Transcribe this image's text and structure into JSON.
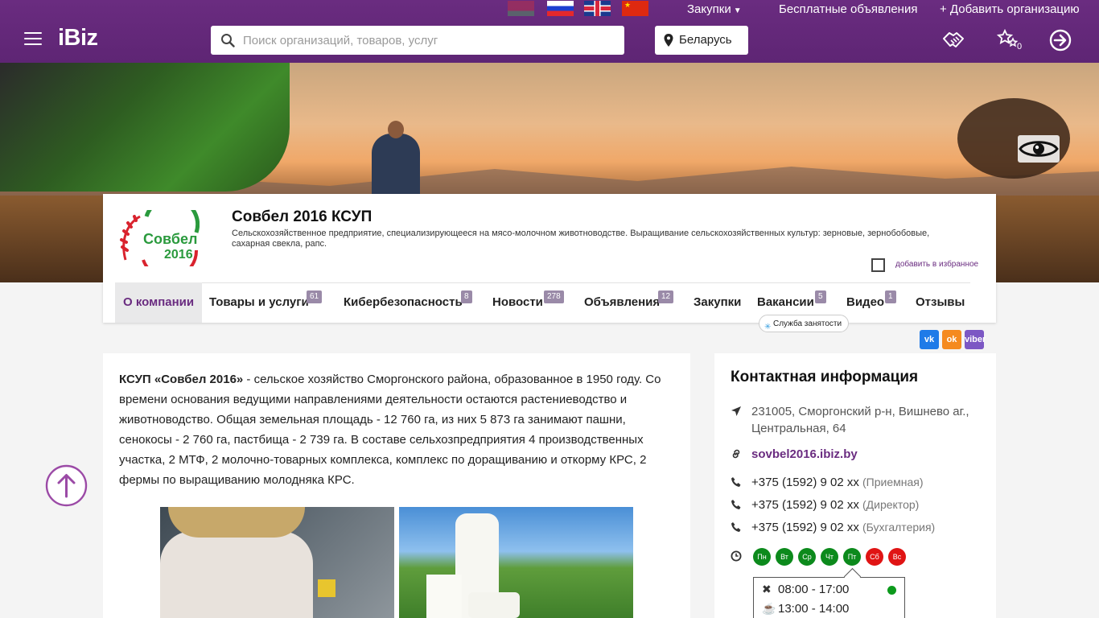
{
  "topbar": {
    "flags": [
      "flag-belarus",
      "flag-russia",
      "flag-uk",
      "flag-china"
    ],
    "procurement_label": "Закупки",
    "free_ads_label": "Бесплатные объявления",
    "add_org_label": "+ Добавить организацию"
  },
  "header": {
    "logo": "iBiz",
    "search_placeholder": "Поиск организаций, товаров, услуг",
    "region": "Беларусь",
    "favorites_count": "0",
    "icons": [
      "handshake-icon",
      "favorites-stars-icon",
      "login-icon"
    ]
  },
  "company": {
    "name": "Совбел 2016 КСУП",
    "description": "Сельскохозяйственное предприятие, специализирующееся на мясо-молочном животноводстве. Выращивание сельскохозяйственных культур: зерновые, зернобобовые, сахарная свекла, рапс.",
    "add_favorite_label": "добавить в избранное",
    "logo_text_1": "Совбел",
    "logo_text_2": "2016"
  },
  "tabs": [
    {
      "label": "О компании",
      "count": ""
    },
    {
      "label": "Товары и услуги",
      "count": "61"
    },
    {
      "label": "Кибербезопасность",
      "count": "8"
    },
    {
      "label": "Новости",
      "count": "278"
    },
    {
      "label": "Объявления",
      "count": "12"
    },
    {
      "label": "Закупки",
      "count": ""
    },
    {
      "label": "Вакансии",
      "count": "5"
    },
    {
      "label": "Видео",
      "count": "1"
    },
    {
      "label": "Отзывы",
      "count": ""
    }
  ],
  "service_chip": "Служба занятости",
  "share": {
    "vk": "vk",
    "ok": "ok",
    "viber": "viber",
    "colors": {
      "vk": "#1f7be8",
      "ok": "#f58a1f",
      "viber": "#7c57c4"
    }
  },
  "about": {
    "lead": "КСУП «Совбел 2016»",
    "text": " - сельское хозяйство Сморгонского района, образованное в 1950 году. Со времени основания ведущими направлениями деятельности остаются растениеводство и животноводство. Общая земельная площадь  - 12 760 га, из них 5 873 га занимают пашни, сенокосы - 2 760 га, пастбища - 2 739 га. В составе сельхозпредприятия 4 производственных участка, 2 МТФ, 2 молочно-товарных комплекса, комплекс по доращиванию и откорму КРС, 2 фермы по выращиванию молодняка КРС."
  },
  "contacts": {
    "title": "Контактная информация",
    "address": "231005, Сморгонский р-н, Вишнево аг., Центральная, 64",
    "site": "sovbel2016.ibiz.by",
    "phones": [
      {
        "number": "+375 (1592) 9 02 xx",
        "note": "(Приемная)"
      },
      {
        "number": "+375 (1592) 9 02 xx",
        "note": "(Директор)"
      },
      {
        "number": "+375 (1592) 9 02 xx",
        "note": "(Бухгалтерия)"
      }
    ],
    "days": [
      {
        "label": "Пн",
        "status": "work"
      },
      {
        "label": "Вт",
        "status": "work"
      },
      {
        "label": "Ср",
        "status": "work"
      },
      {
        "label": "Чт",
        "status": "work"
      },
      {
        "label": "Пт",
        "status": "work"
      },
      {
        "label": "Сб",
        "status": "off"
      },
      {
        "label": "Вс",
        "status": "off"
      }
    ],
    "work_hours": "08:00 - 17:00",
    "lunch_hours": "13:00 - 14:00"
  },
  "colors": {
    "brand": "#6a2c80",
    "work_day": "#0c8a1c",
    "off_day": "#e01414"
  }
}
